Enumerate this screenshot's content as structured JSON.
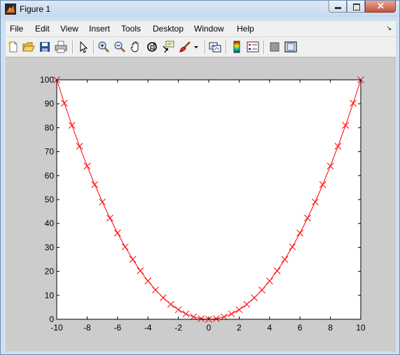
{
  "window": {
    "title": "Figure 1",
    "menu": [
      "File",
      "Edit",
      "View",
      "Insert",
      "Tools",
      "Desktop",
      "Window",
      "Help"
    ],
    "toolbar_icons": [
      "new-figure-icon",
      "open-file-icon",
      "save-icon",
      "print-icon",
      "edit-plot-arrow-icon",
      "zoom-in-icon",
      "zoom-out-icon",
      "pan-hand-icon",
      "rotate-3d-icon",
      "data-cursor-icon",
      "brush-icon",
      "brush-dropdown-icon",
      "link-plot-icon",
      "insert-colorbar-icon",
      "insert-legend-icon",
      "hide-plot-tools-icon",
      "show-plot-tools-icon"
    ]
  },
  "chart_data": {
    "type": "line",
    "title": "",
    "xlabel": "",
    "ylabel": "",
    "xlim": [
      -10,
      10
    ],
    "ylim": [
      0,
      100
    ],
    "xticks": [
      -10,
      -8,
      -6,
      -4,
      -2,
      0,
      2,
      4,
      6,
      8,
      10
    ],
    "yticks": [
      0,
      10,
      20,
      30,
      40,
      50,
      60,
      70,
      80,
      90,
      100
    ],
    "grid": false,
    "series": [
      {
        "color": "#ff0000",
        "marker": "x",
        "x": [
          -10,
          -9.5,
          -9,
          -8.5,
          -8,
          -7.5,
          -7,
          -6.5,
          -6,
          -5.5,
          -5,
          -4.5,
          -4,
          -3.5,
          -3,
          -2.5,
          -2,
          -1.5,
          -1,
          -0.5,
          0,
          0.5,
          1,
          1.5,
          2,
          2.5,
          3,
          3.5,
          4,
          4.5,
          5,
          5.5,
          6,
          6.5,
          7,
          7.5,
          8,
          8.5,
          9,
          9.5,
          10
        ],
        "y": [
          100,
          90.25,
          81,
          72.25,
          64,
          56.25,
          49,
          42.25,
          36,
          30.25,
          25,
          20.25,
          16,
          12.25,
          9,
          6.25,
          4,
          2.25,
          1,
          0.25,
          0,
          0.25,
          1,
          2.25,
          4,
          6.25,
          9,
          12.25,
          16,
          20.25,
          25,
          30.25,
          36,
          42.25,
          49,
          56.25,
          64,
          72.25,
          81,
          90.25,
          100
        ]
      }
    ]
  }
}
